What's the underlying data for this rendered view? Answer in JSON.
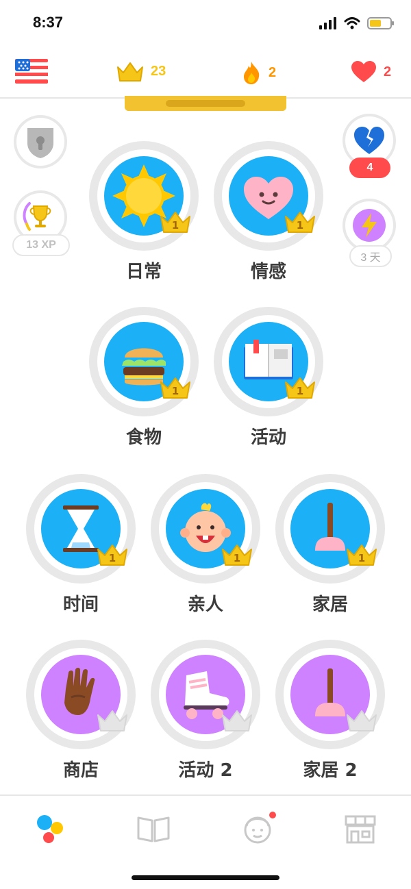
{
  "status_bar": {
    "time": "8:37"
  },
  "top_stats": {
    "crowns": "23",
    "streak": "2",
    "hearts": "2",
    "colors": {
      "crowns": "#f5c518",
      "streak": "#ff9600",
      "hearts": "#ff4b4b"
    }
  },
  "side": {
    "xp_label": "13 XP",
    "broken_hearts_count": "4",
    "days_label": "3 天"
  },
  "skills": [
    {
      "name": "日常",
      "icon": "sun-icon",
      "crown": "1",
      "color": "#1cb0f6"
    },
    {
      "name": "情感",
      "icon": "heart-face-icon",
      "crown": "1",
      "color": "#1cb0f6"
    },
    {
      "name": "食物",
      "icon": "burger-icon",
      "crown": "1",
      "color": "#1cb0f6"
    },
    {
      "name": "活动",
      "icon": "book-icon",
      "crown": "1",
      "color": "#1cb0f6"
    },
    {
      "name": "时间",
      "icon": "hourglass-icon",
      "crown": "1",
      "color": "#1cb0f6"
    },
    {
      "name": "亲人",
      "icon": "baby-icon",
      "crown": "1",
      "color": "#1cb0f6"
    },
    {
      "name": "家居",
      "icon": "plunger-icon",
      "crown": "1",
      "color": "#1cb0f6"
    },
    {
      "name": "商店",
      "icon": "glove-icon",
      "crown": "",
      "color": "#ce82ff"
    },
    {
      "name": "活动 2",
      "icon": "roller-skate-icon",
      "crown": "",
      "color": "#ce82ff"
    },
    {
      "name": "家居 2",
      "icon": "plunger-icon",
      "crown": "",
      "color": "#ce82ff"
    }
  ],
  "bottom_nav": [
    "learn-icon",
    "stories-icon",
    "profile-icon",
    "shop-icon"
  ]
}
